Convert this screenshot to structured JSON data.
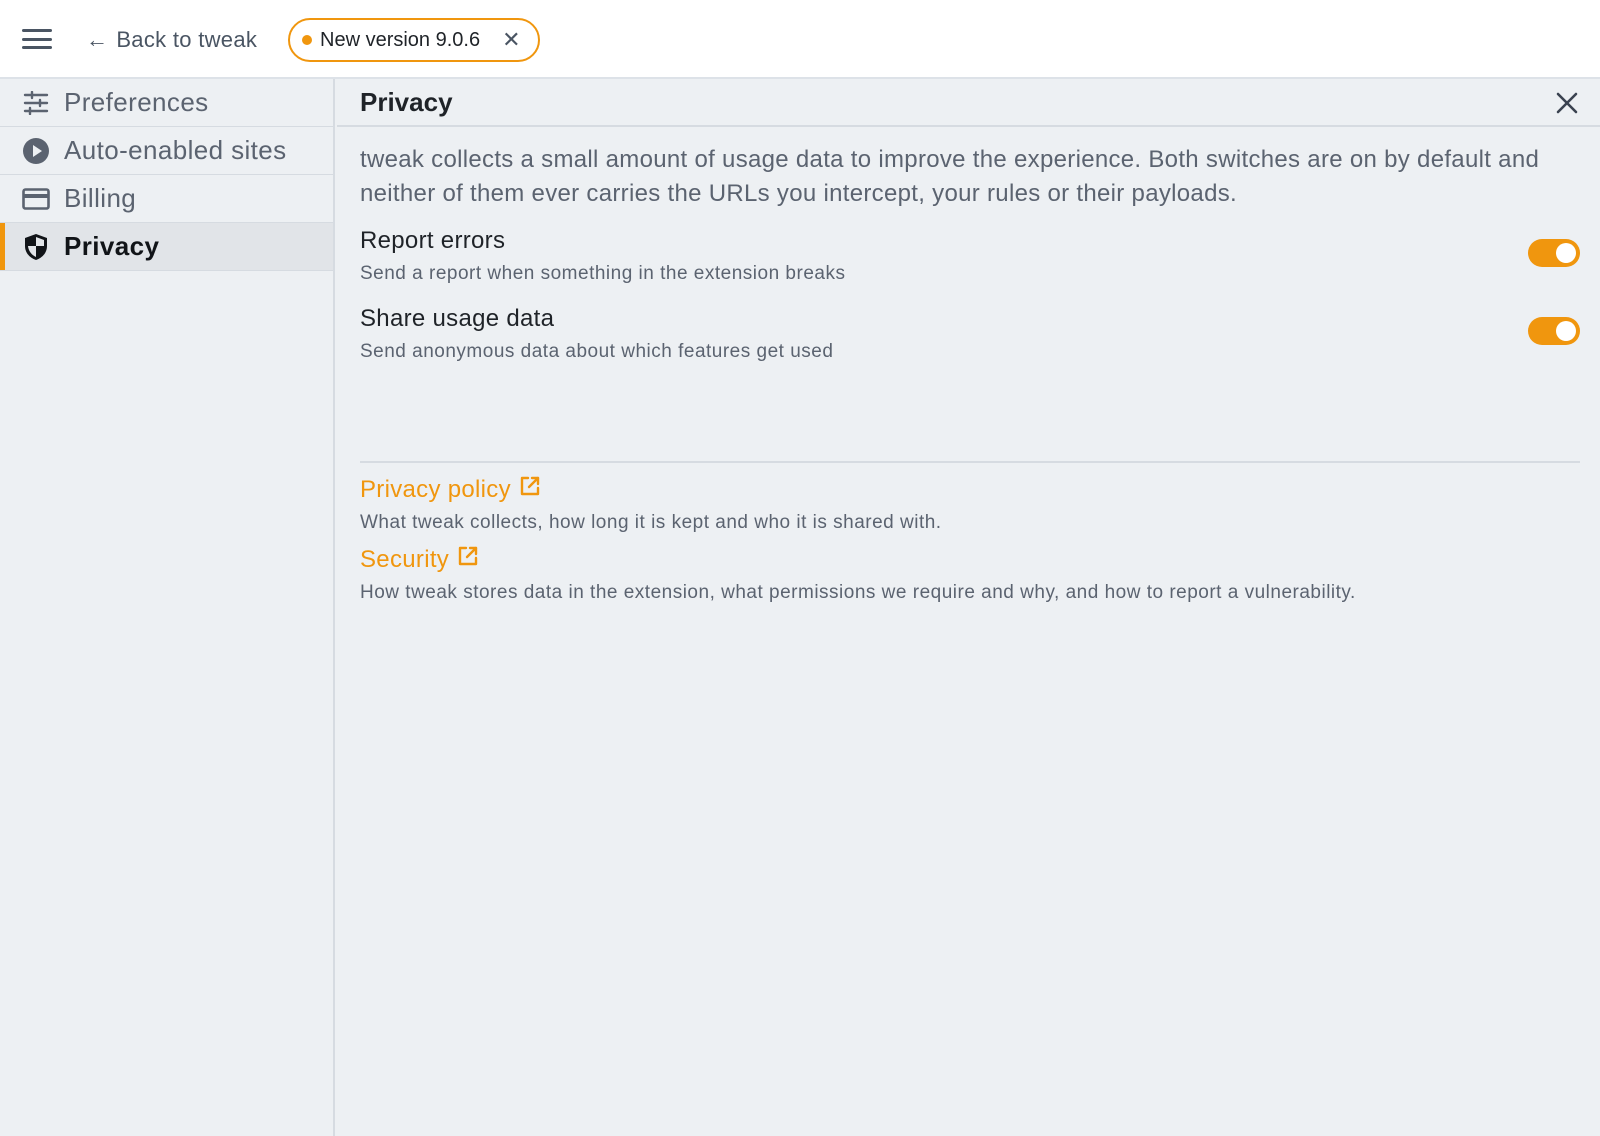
{
  "topbar": {
    "back_label": "Back to tweak",
    "version_label": "New version 9.0.6",
    "accent_color": "#f0960e"
  },
  "sidebar": {
    "items": [
      {
        "label": "Preferences",
        "icon": "sliders-icon",
        "active": false
      },
      {
        "label": "Auto-enabled sites",
        "icon": "play-circle-icon",
        "active": false
      },
      {
        "label": "Billing",
        "icon": "credit-card-icon",
        "active": false
      },
      {
        "label": "Privacy",
        "icon": "shield-icon",
        "active": true
      }
    ]
  },
  "main": {
    "title": "Privacy",
    "intro": "tweak collects a small amount of usage data to improve the experience. Both switches are on by default and neither of them ever carries the URLs you intercept, your rules or their payloads.",
    "settings": [
      {
        "label": "Report errors",
        "description": "Send a report when something in the extension breaks",
        "enabled": true
      },
      {
        "label": "Share usage data",
        "description": "Send anonymous data about which features get used",
        "enabled": true
      }
    ],
    "links": [
      {
        "label": "Privacy policy",
        "description": "What tweak collects, how long it is kept and who it is shared with."
      },
      {
        "label": "Security",
        "description": "How tweak stores data in the extension, what permissions we require and why, and how to report a vulnerability."
      }
    ]
  }
}
